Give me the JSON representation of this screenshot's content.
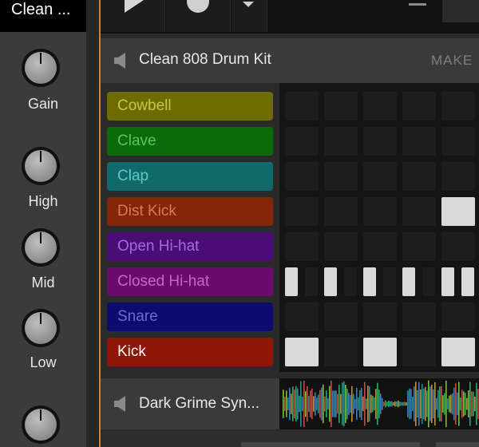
{
  "strip": {
    "title": "Clean ...",
    "knobs": [
      {
        "label": "Gain"
      },
      {
        "label": "High"
      },
      {
        "label": "Mid"
      },
      {
        "label": "Low"
      },
      {
        "label": ""
      }
    ]
  },
  "transport": {
    "play": "play-icon",
    "record": "record-icon",
    "dropdown": "chevron-down-icon"
  },
  "track": {
    "name": "Clean 808 Drum Kit",
    "make_label": "MAKE",
    "speaker_icon": "speaker-icon"
  },
  "pads": [
    {
      "label": "Cowbell",
      "bg": "#6e6b00",
      "fg": "#c9c44a"
    },
    {
      "label": "Clave",
      "bg": "#0b6b0b",
      "fg": "#57c657"
    },
    {
      "label": "Clap",
      "bg": "#116a6a",
      "fg": "#5ec8c8"
    },
    {
      "label": "Dist Kick",
      "bg": "#852508",
      "fg": "#d97a55"
    },
    {
      "label": "Open Hi-hat",
      "bg": "#4a0d78",
      "fg": "#a66ad6"
    },
    {
      "label": "Closed Hi-hat",
      "bg": "#6b0a6b",
      "fg": "#c766c7"
    },
    {
      "label": "Snare",
      "bg": "#0c0c70",
      "fg": "#6a6ad4"
    },
    {
      "label": "Kick",
      "bg": "#8e1607",
      "fg": "#ffffff"
    }
  ],
  "steps": [
    [
      0,
      0,
      0,
      0,
      0
    ],
    [
      0,
      0,
      0,
      0,
      0
    ],
    [
      0,
      0,
      0,
      0,
      0
    ],
    [
      0,
      0,
      0,
      0,
      1
    ],
    [
      0,
      0,
      0,
      0,
      0
    ],
    [
      1,
      0,
      1,
      0,
      1,
      0,
      1,
      0,
      1,
      1
    ],
    [
      0,
      0,
      0,
      0,
      0
    ],
    [
      1,
      0,
      1,
      0,
      1
    ]
  ],
  "bottom_track": {
    "name": "Dark Grime Syn..."
  }
}
